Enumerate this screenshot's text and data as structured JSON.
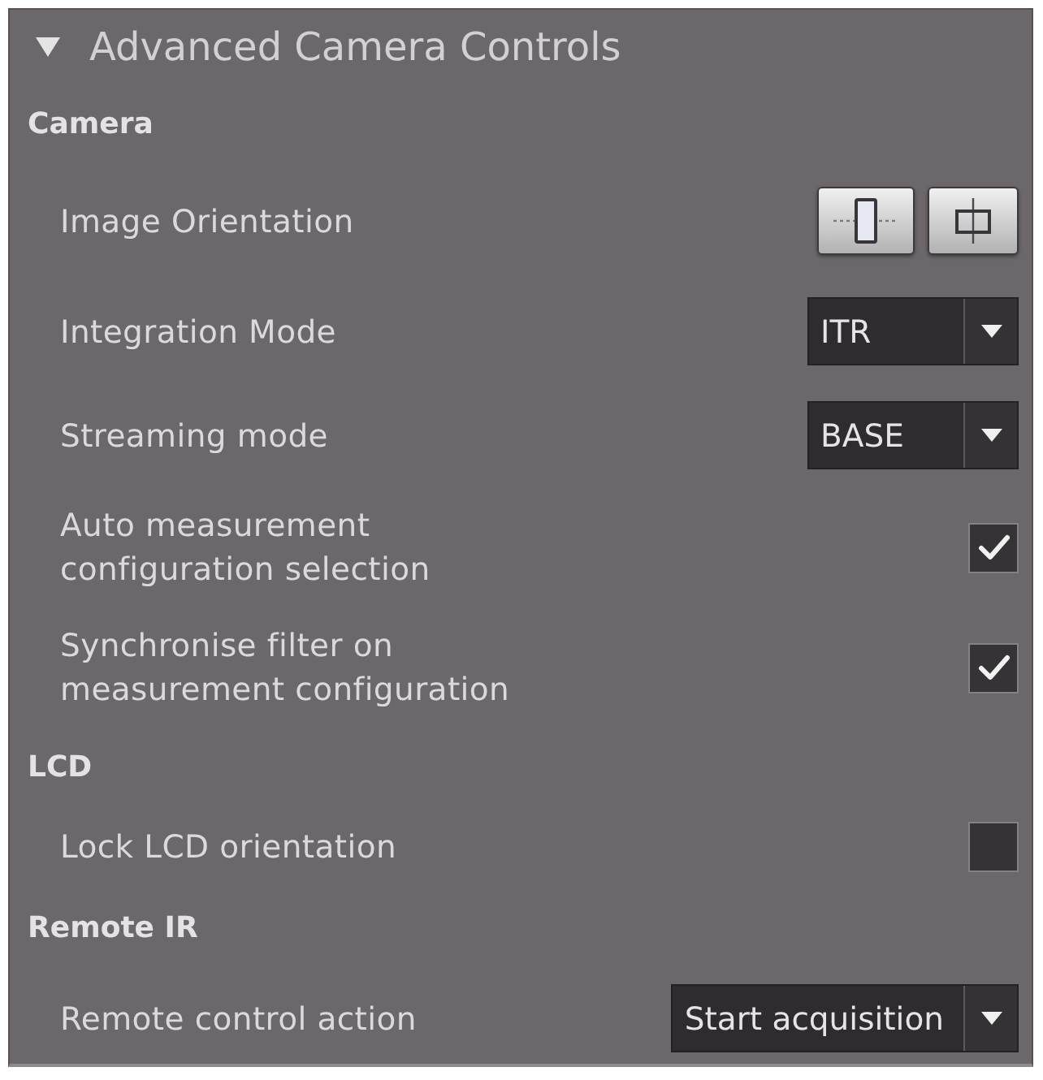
{
  "panel": {
    "title": "Advanced Camera Controls",
    "expanded": true
  },
  "sections": [
    {
      "title": "Camera",
      "rows": [
        {
          "kind": "buttons",
          "label": "Image Orientation",
          "buttons": [
            {
              "kind": "portrait"
            },
            {
              "kind": "landscape"
            }
          ]
        },
        {
          "kind": "dropdown",
          "label": "Integration Mode",
          "value": "ITR"
        },
        {
          "kind": "dropdown",
          "label": "Streaming mode",
          "value": "BASE"
        },
        {
          "kind": "checkbox",
          "label": "Auto measurement configuration selection",
          "checked": true
        },
        {
          "kind": "checkbox",
          "label": "Synchronise filter on measurement configuration",
          "checked": true
        }
      ]
    },
    {
      "title": "LCD",
      "rows": [
        {
          "kind": "checkbox",
          "label": "Lock LCD orientation",
          "checked": false
        }
      ]
    },
    {
      "title": "Remote IR",
      "rows": [
        {
          "kind": "dropdown",
          "label": "Remote control action",
          "value": "Start acquisition"
        }
      ]
    }
  ]
}
